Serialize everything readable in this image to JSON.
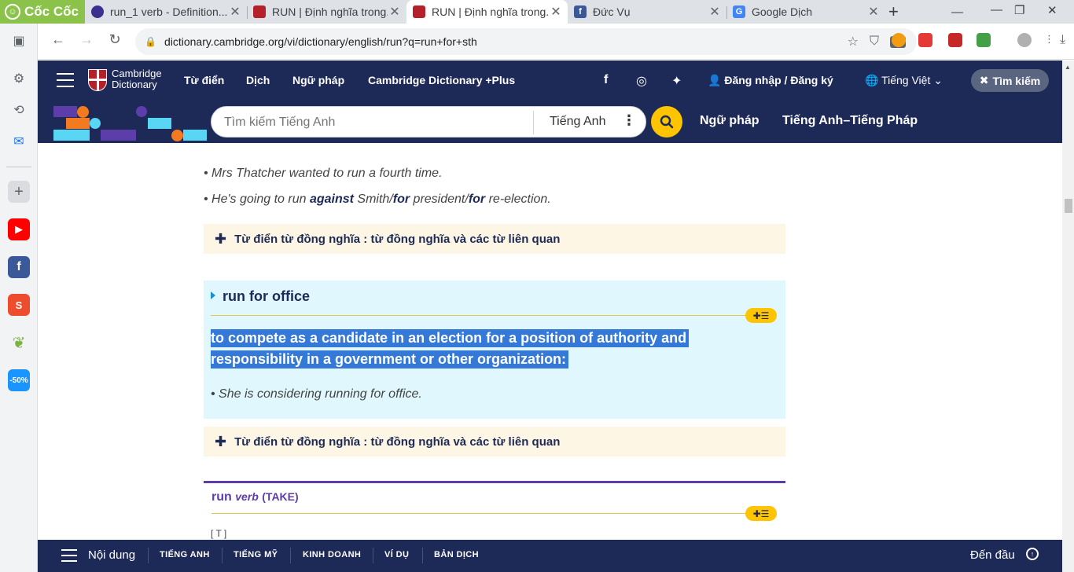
{
  "browser": {
    "brand": "Cốc Cốc",
    "tabs": [
      {
        "title": "run_1 verb - Definition...",
        "active": false,
        "favicon_color": "#3b2f8f"
      },
      {
        "title": "RUN | Định nghĩa trong...",
        "active": false,
        "favicon_color": "#b5212b"
      },
      {
        "title": "RUN | Định nghĩa trong...",
        "active": true,
        "favicon_color": "#b5212b"
      },
      {
        "title": "Đức Vụ",
        "active": false,
        "favicon_color": "#3b5998"
      },
      {
        "title": "Google Dịch",
        "active": false,
        "favicon_color": "#4285f4"
      }
    ],
    "url": "dictionary.cambridge.org/vi/dictionary/english/run?q=run+for+sth"
  },
  "sidebar_apps": [
    {
      "name": "youtube",
      "color": "#ff0000"
    },
    {
      "name": "facebook",
      "color": "#3b5998"
    },
    {
      "name": "shopee",
      "color": "#ee4d2d"
    },
    {
      "name": "tiki",
      "label": "-50%",
      "color": "#1a94ff"
    }
  ],
  "camnav": {
    "brand_line1": "Cambridge",
    "brand_line2": "Dictionary",
    "links": [
      "Từ điển",
      "Dịch",
      "Ngữ pháp",
      "Cambridge Dictionary +Plus"
    ],
    "login": "Đăng nhập / Đăng ký",
    "language": "Tiếng Việt",
    "close_search": "Tìm kiếm"
  },
  "search": {
    "placeholder": "Tìm kiếm Tiếng Anh",
    "dictionary": "Tiếng Anh",
    "links": [
      "Ngữ pháp",
      "Tiếng Anh–Tiếng Pháp"
    ]
  },
  "content": {
    "examples_top": [
      {
        "pre": "Mrs Thatcher wanted to run a fourth time."
      },
      {
        "pre": "He's going to run ",
        "b1": "against",
        "mid1": " Smith/",
        "b2": "for",
        "mid2": " president/",
        "b3": "for",
        "post": " re-election."
      }
    ],
    "thesaurus_label": "Từ điển từ đồng nghĩa : từ đồng nghĩa và các từ liên quan",
    "phrase": {
      "title": "run for office",
      "definition": "to compete as a candidate in an election for a position of authority and responsibility in a government or other organization:",
      "example": "She is considering running for office."
    },
    "entry": {
      "headword": "run",
      "pos": "verb",
      "guideword": "(TAKE)",
      "grammar": "[ T ]"
    }
  },
  "bottombar": {
    "contents": "Nội dung",
    "links": [
      "TIẾNG ANH",
      "TIẾNG MỸ",
      "KINH DOANH",
      "VÍ DỤ",
      "BẢN DỊCH"
    ],
    "totop": "Đến đầu"
  }
}
